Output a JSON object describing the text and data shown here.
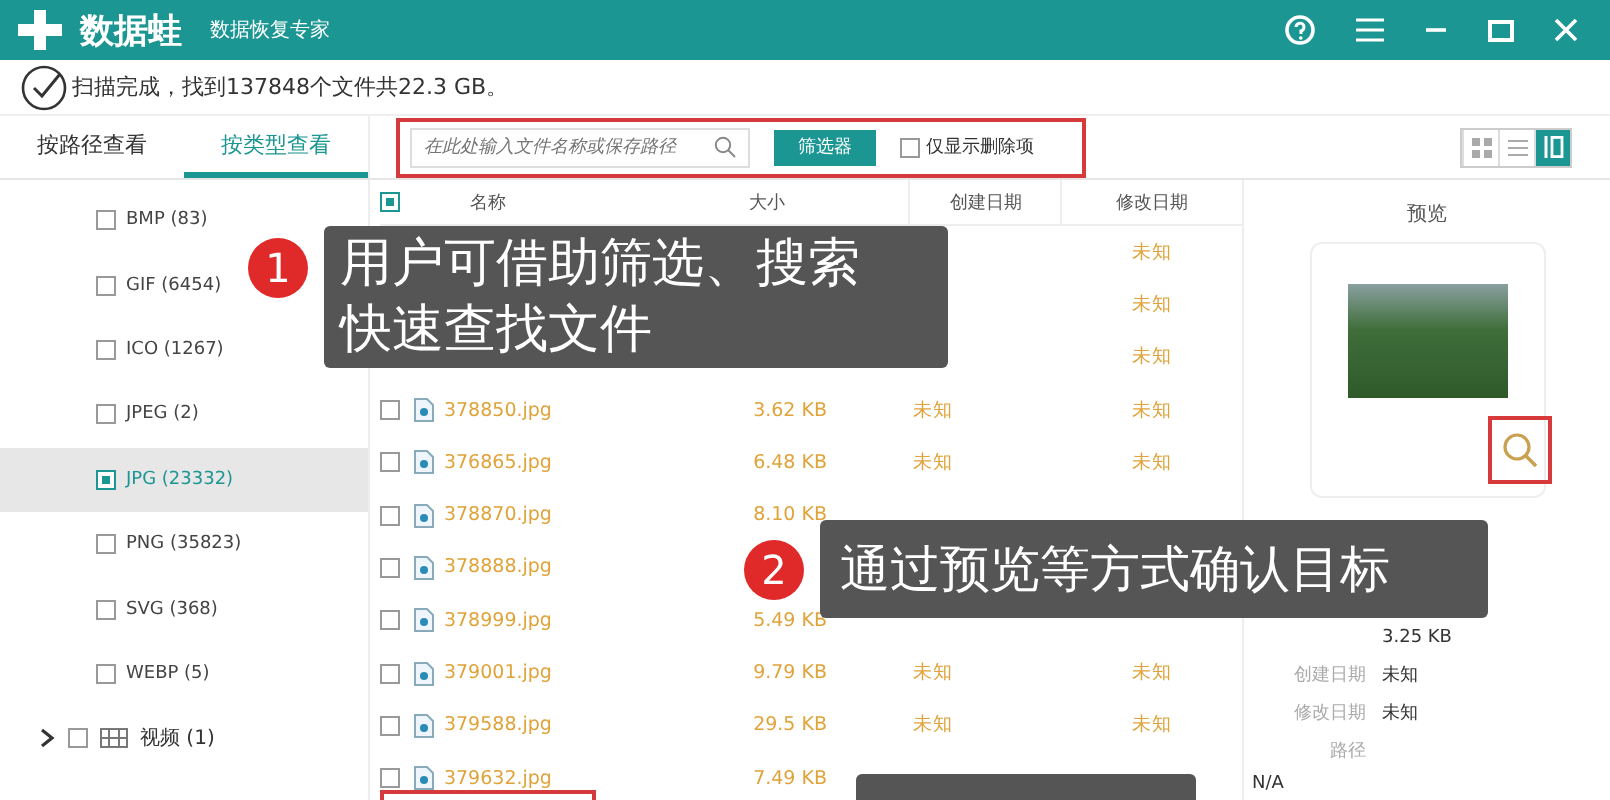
{
  "window": {
    "app_name": "数据蛙",
    "subtitle": "数据恢复专家"
  },
  "status": "扫描完成，找到137848个文件共22.3 GB。",
  "tabs": [
    {
      "label": "按路径查看",
      "selected": false
    },
    {
      "label": "按类型查看",
      "selected": true
    }
  ],
  "search": {
    "placeholder": "在此处输入文件名称或保存路径"
  },
  "filter_button": "筛选器",
  "deleted_only": {
    "label": "仅显示删除项",
    "checked": false
  },
  "view_modes": [
    {
      "kind": "grid",
      "selected": false
    },
    {
      "kind": "list",
      "selected": false
    },
    {
      "kind": "detail",
      "selected": true
    }
  ],
  "sidebar": {
    "items": [
      {
        "label": "BMP (83)",
        "checked": false,
        "selected": false
      },
      {
        "label": "GIF (6454)",
        "checked": false,
        "selected": false
      },
      {
        "label": "ICO (1267)",
        "checked": false,
        "selected": false
      },
      {
        "label": "JPEG (2)",
        "checked": false,
        "selected": false
      },
      {
        "label": "JPG (23332)",
        "checked": true,
        "selected": true
      },
      {
        "label": "PNG (35823)",
        "checked": false,
        "selected": false
      },
      {
        "label": "SVG (368)",
        "checked": false,
        "selected": false
      },
      {
        "label": "WEBP (5)",
        "checked": false,
        "selected": false
      }
    ],
    "groups": [
      {
        "label": "视频 (1)",
        "checked": false,
        "expanded": false
      }
    ]
  },
  "table": {
    "header_checked": true,
    "columns": [
      "名称",
      "大小",
      "创建日期",
      "修改日期"
    ],
    "rows": [
      {
        "modified": "未知"
      },
      {
        "modified": "未知"
      },
      {
        "modified": "未知"
      },
      {
        "checked": false,
        "name": "378850.jpg",
        "size": "3.62 KB",
        "created": "未知",
        "modified": "未知"
      },
      {
        "checked": false,
        "name": "376865.jpg",
        "size": "6.48 KB",
        "created": "未知",
        "modified": "未知"
      },
      {
        "checked": false,
        "name": "378870.jpg",
        "size": "8.10 KB"
      },
      {
        "checked": false,
        "name": "378888.jpg"
      },
      {
        "checked": false,
        "name": "378999.jpg",
        "size": "5.49 KB"
      },
      {
        "checked": false,
        "name": "379001.jpg",
        "size": "9.79 KB",
        "created": "未知",
        "modified": "未知"
      },
      {
        "checked": false,
        "name": "379588.jpg",
        "size": "29.5 KB",
        "created": "未知",
        "modified": "未知"
      },
      {
        "checked": false,
        "name": "379632.jpg",
        "size": "7.49 KB"
      }
    ]
  },
  "preview": {
    "title": "预览",
    "details": [
      {
        "value": "3.25 KB"
      },
      {
        "label": "创建日期",
        "value": "未知"
      },
      {
        "label": "修改日期",
        "value": "未知"
      },
      {
        "label": "路径"
      }
    ],
    "path": "N/A"
  },
  "callouts": [
    {
      "number": "1",
      "lines": [
        "用户可借助筛选、搜索",
        "快速查找文件"
      ]
    },
    {
      "number": "2",
      "lines": [
        "通过预览等方式确认目标"
      ]
    }
  ]
}
